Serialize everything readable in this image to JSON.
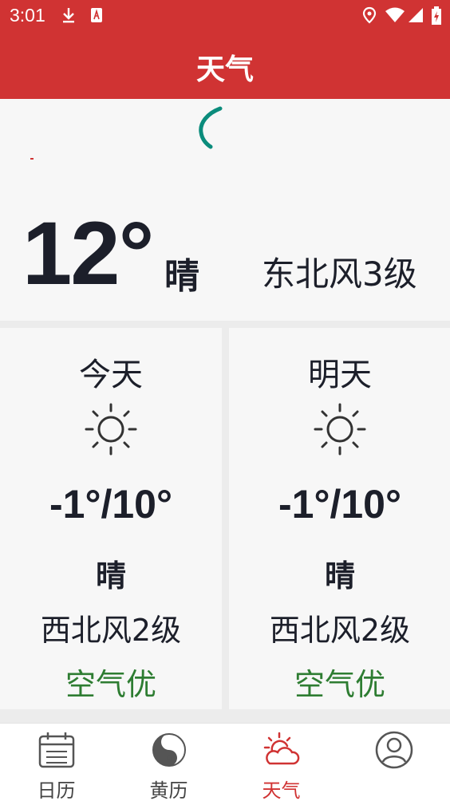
{
  "status_bar": {
    "time": "3:01"
  },
  "app_bar": {
    "title": "天气"
  },
  "current": {
    "temperature": "12°",
    "condition": "晴",
    "wind": "东北风3级"
  },
  "forecast": [
    {
      "day": "今天",
      "icon": "sun-icon",
      "range": "-1°/10°",
      "condition": "晴",
      "wind": "西北风2级",
      "air": "空气优"
    },
    {
      "day": "明天",
      "icon": "sun-icon",
      "range": "-1°/10°",
      "condition": "晴",
      "wind": "西北风2级",
      "air": "空气优"
    }
  ],
  "nav": {
    "items": [
      {
        "label": "日历",
        "icon": "calendar-icon"
      },
      {
        "label": "黄历",
        "icon": "yin-yang-icon"
      },
      {
        "label": "天气",
        "icon": "weather-icon",
        "active": true
      },
      {
        "label": "",
        "icon": "profile-icon"
      }
    ]
  },
  "colors": {
    "accent": "#d03333",
    "air_good": "#2e7d32",
    "spinner": "#0b8c7c"
  }
}
